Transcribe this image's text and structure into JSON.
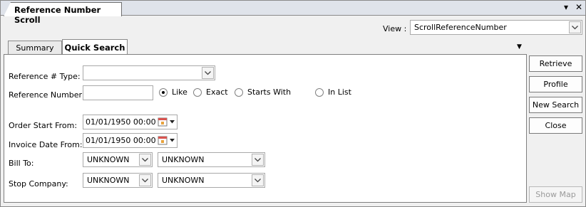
{
  "window": {
    "title": "Reference Number Scroll",
    "pin_glyph": "▾",
    "close_glyph": "✕"
  },
  "view": {
    "label": "View :",
    "selected": "ScrollReferenceNumber"
  },
  "tabs": [
    {
      "label": "Summary"
    },
    {
      "label": "Quick Search"
    }
  ],
  "tab_menu_glyph": "▼",
  "form": {
    "ref_type_label": "Reference # Type:",
    "ref_type_value": "",
    "ref_number_label": "Reference Number:",
    "ref_number_value": "",
    "match_options": [
      {
        "label": "Like",
        "checked": true
      },
      {
        "label": "Exact",
        "checked": false
      },
      {
        "label": "Starts With",
        "checked": false
      },
      {
        "label": "In List",
        "checked": false
      }
    ],
    "order_start_label": "Order Start From:",
    "order_start_value": "01/01/1950 00:00",
    "invoice_date_label": "Invoice Date From:",
    "invoice_date_value": "01/01/1950 00:00",
    "bill_to_label": "Bill To:",
    "bill_to_code": "UNKNOWN",
    "bill_to_name": "UNKNOWN",
    "stop_company_label": "Stop Company:",
    "stop_company_code": "UNKNOWN",
    "stop_company_name": "UNKNOWN"
  },
  "buttons": {
    "retrieve": "Retrieve",
    "profile": "Profile",
    "new_search": "New Search",
    "close": "Close",
    "show_map": "Show Map"
  }
}
